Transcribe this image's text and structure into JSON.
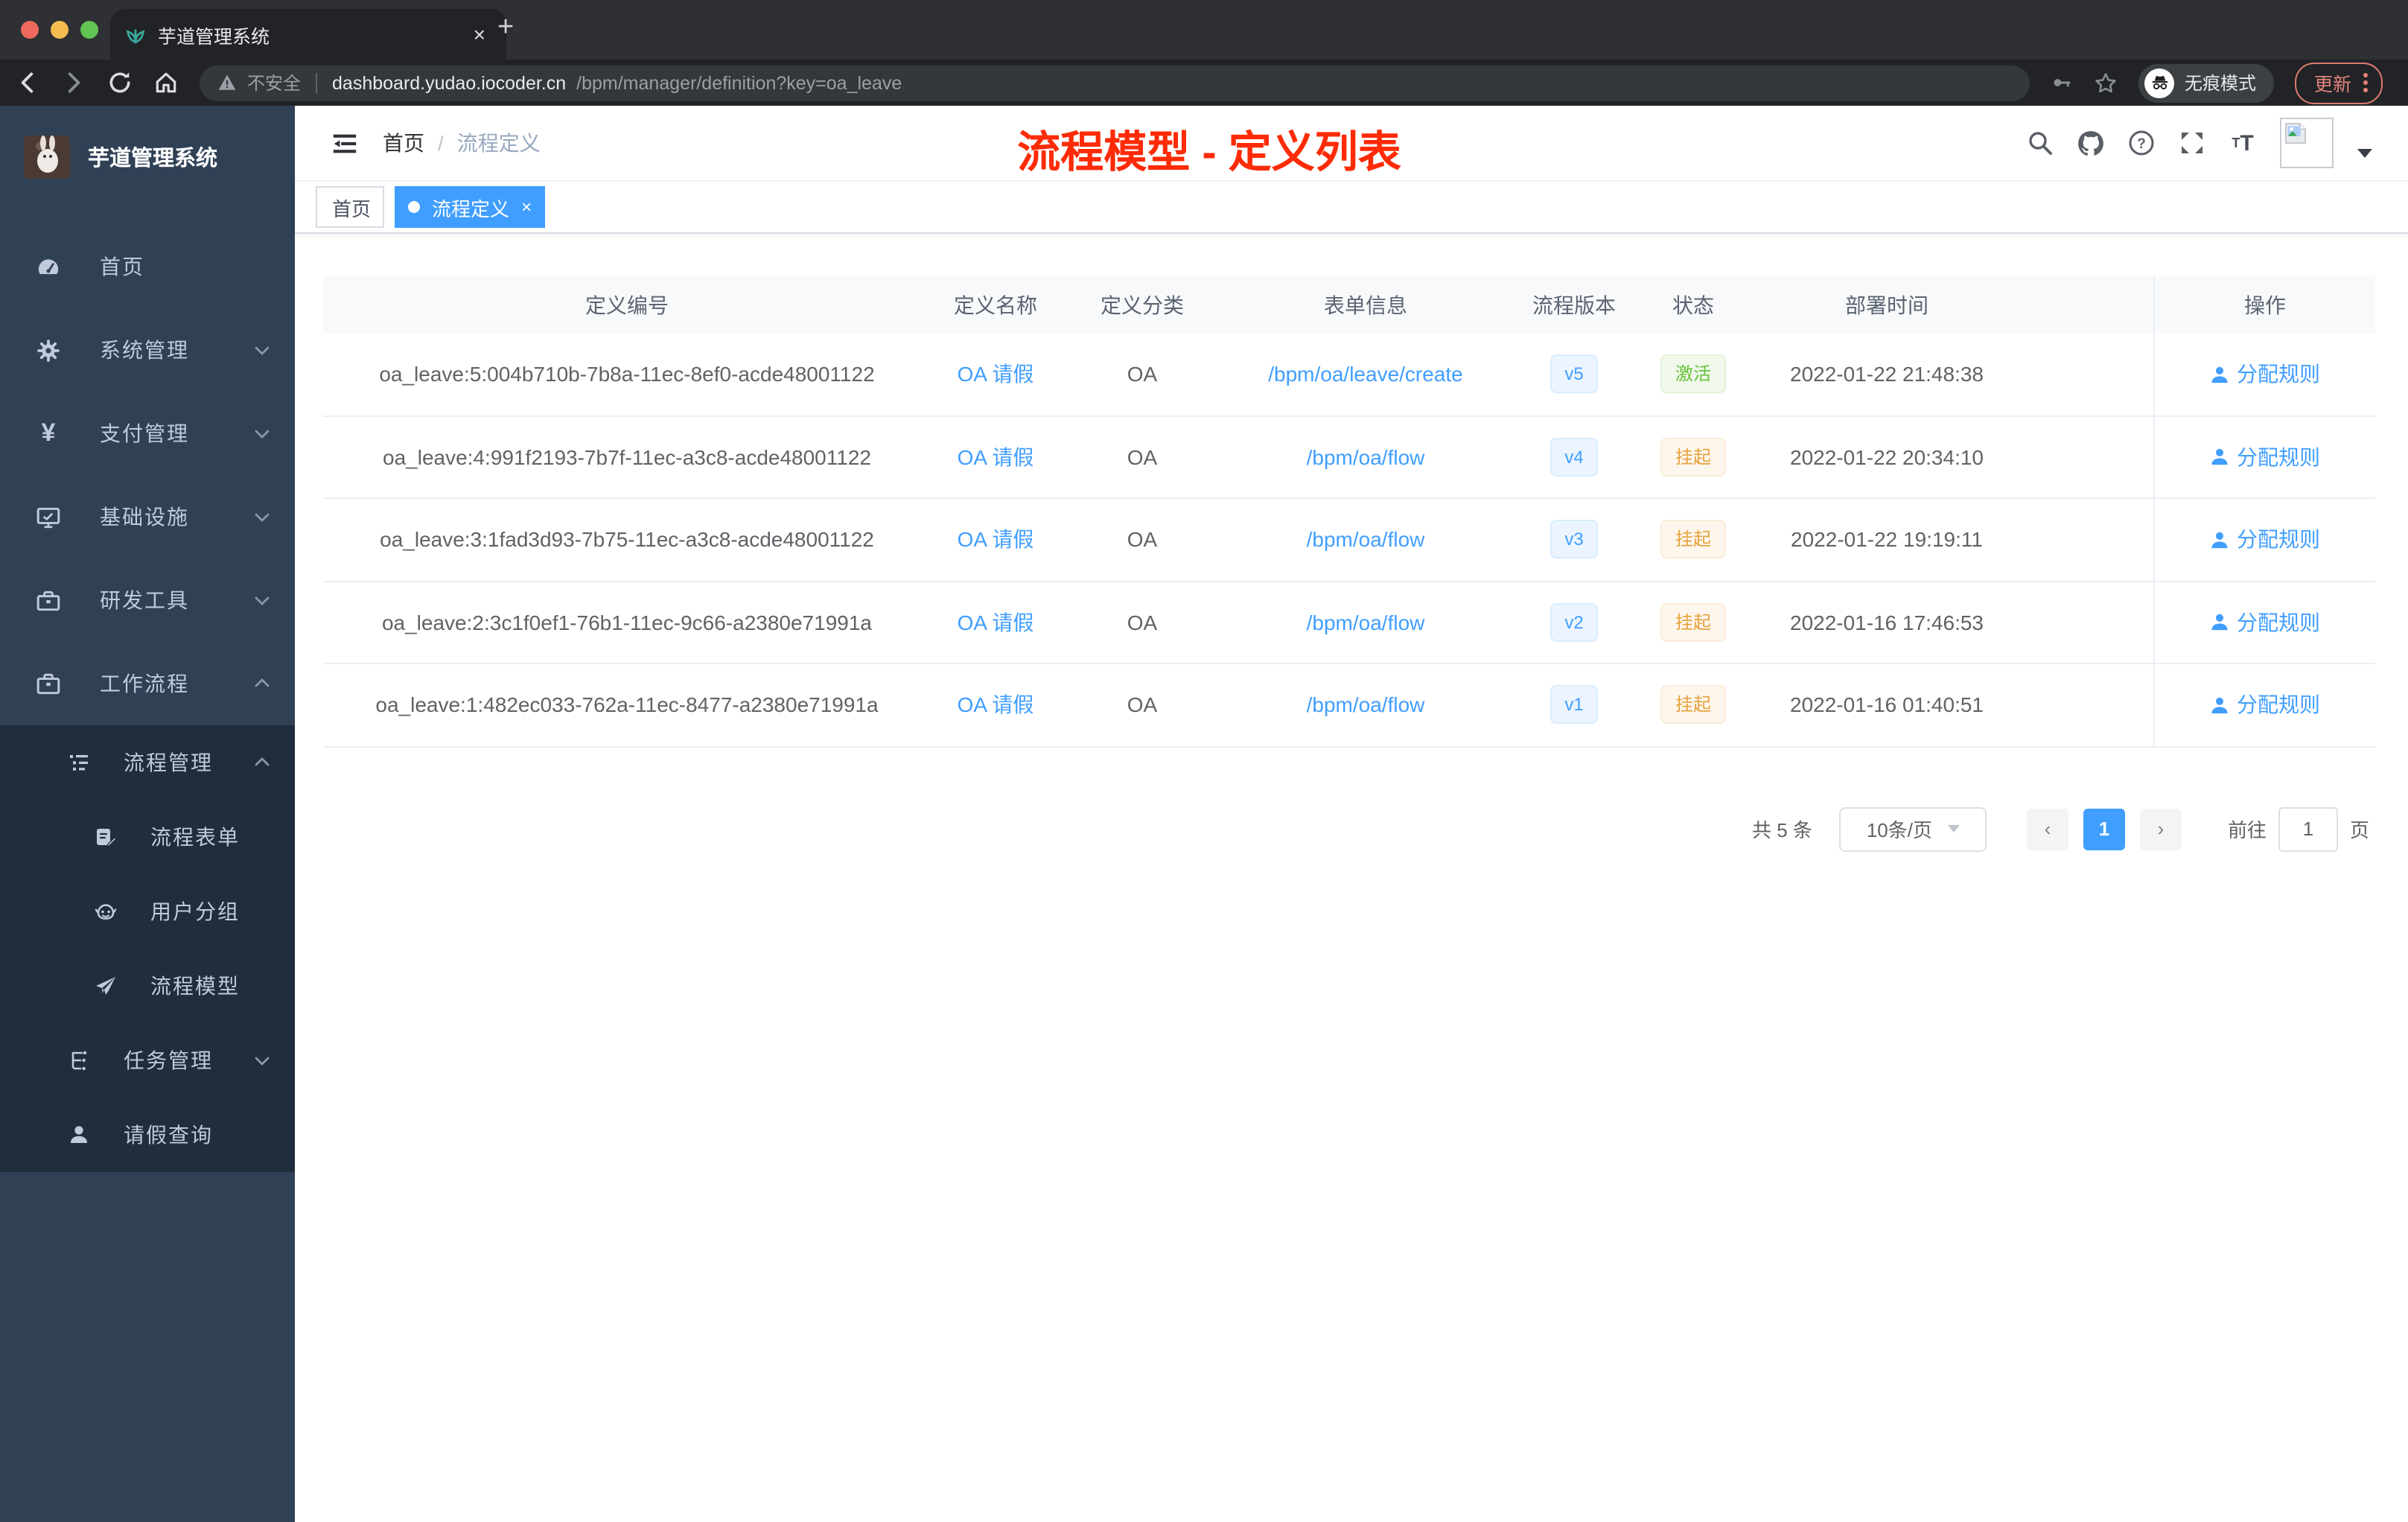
{
  "browser": {
    "tab_title": "芋道管理系统",
    "new_tab": "+",
    "close_tab": "×",
    "security_label": "不安全",
    "url_host": "dashboard.yudao.iocoder.cn",
    "url_path": "/bpm/manager/definition?key=oa_leave",
    "incognito_label": "无痕模式",
    "update_label": "更新"
  },
  "sidebar": {
    "app_title": "芋道管理系统",
    "items": [
      {
        "label": "首页",
        "icon": "dashboard-icon"
      },
      {
        "label": "系统管理",
        "icon": "gear-icon"
      },
      {
        "label": "支付管理",
        "icon": "yen-icon"
      },
      {
        "label": "基础设施",
        "icon": "monitor-icon"
      },
      {
        "label": "研发工具",
        "icon": "toolbox-icon"
      },
      {
        "label": "工作流程",
        "icon": "briefcase-icon"
      }
    ],
    "submenu": [
      {
        "label": "流程管理",
        "icon": "workflow-icon"
      },
      {
        "label": "流程表单",
        "icon": "form-icon"
      },
      {
        "label": "用户分组",
        "icon": "usergroup-icon"
      },
      {
        "label": "流程模型",
        "icon": "model-icon"
      },
      {
        "label": "任务管理",
        "icon": "task-icon"
      },
      {
        "label": "请假查询",
        "icon": "user-icon"
      }
    ]
  },
  "header": {
    "breadcrumb": [
      "首页",
      "流程定义"
    ],
    "separator": "/",
    "annotation": "流程模型 - 定义列表"
  },
  "tags_view": {
    "tabs": [
      {
        "label": "首页",
        "active": false
      },
      {
        "label": "流程定义",
        "active": true
      }
    ]
  },
  "table": {
    "columns": [
      "定义编号",
      "定义名称",
      "定义分类",
      "表单信息",
      "流程版本",
      "状态",
      "部署时间",
      "操作"
    ],
    "action_label": "分配规则",
    "rows": [
      {
        "id": "oa_leave:5:004b710b-7b8a-11ec-8ef0-acde48001122",
        "name": "OA 请假",
        "category": "OA",
        "form": "/bpm/oa/leave/create",
        "version": "v5",
        "status": "激活",
        "status_type": "success",
        "time": "2022-01-22 21:48:38"
      },
      {
        "id": "oa_leave:4:991f2193-7b7f-11ec-a3c8-acde48001122",
        "name": "OA 请假",
        "category": "OA",
        "form": "/bpm/oa/flow",
        "version": "v4",
        "status": "挂起",
        "status_type": "warning",
        "time": "2022-01-22 20:34:10"
      },
      {
        "id": "oa_leave:3:1fad3d93-7b75-11ec-a3c8-acde48001122",
        "name": "OA 请假",
        "category": "OA",
        "form": "/bpm/oa/flow",
        "version": "v3",
        "status": "挂起",
        "status_type": "warning",
        "time": "2022-01-22 19:19:11"
      },
      {
        "id": "oa_leave:2:3c1f0ef1-76b1-11ec-9c66-a2380e71991a",
        "name": "OA 请假",
        "category": "OA",
        "form": "/bpm/oa/flow",
        "version": "v2",
        "status": "挂起",
        "status_type": "warning",
        "time": "2022-01-16 17:46:53"
      },
      {
        "id": "oa_leave:1:482ec033-762a-11ec-8477-a2380e71991a",
        "name": "OA 请假",
        "category": "OA",
        "form": "/bpm/oa/flow",
        "version": "v1",
        "status": "挂起",
        "status_type": "warning",
        "time": "2022-01-16 01:40:51"
      }
    ]
  },
  "pagination": {
    "total": "共 5 条",
    "page_size": "10条/页",
    "prev": "‹",
    "next": "›",
    "current": "1",
    "goto_label": "前往",
    "goto_value": "1",
    "page_label": "页"
  },
  "colors": {
    "accent": "#409eff",
    "status_active": "#67c23a",
    "status_suspended": "#e6a23c",
    "annotation_red": "#fd2b06",
    "sidebar_bg": "#304156",
    "submenu_bg": "#1f2d3d"
  }
}
